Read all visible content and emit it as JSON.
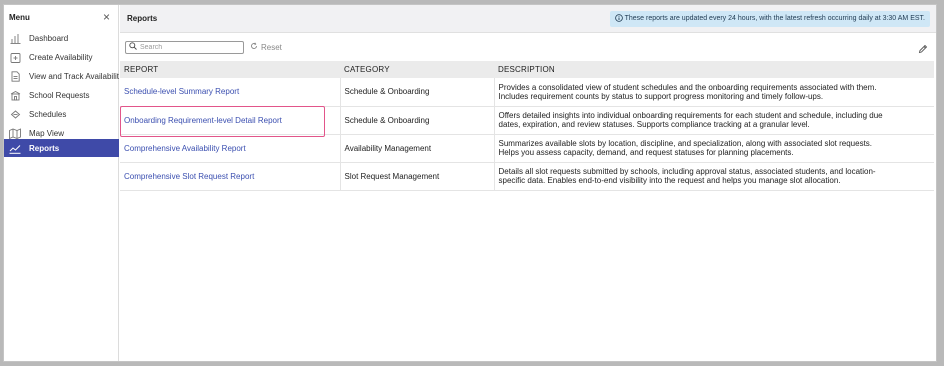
{
  "sidebar": {
    "title": "Menu",
    "close_icon": "×",
    "items": [
      {
        "label": "Dashboard",
        "icon": "bar-chart-icon",
        "active": false
      },
      {
        "label": "Create Availability",
        "icon": "calendar-plus-icon",
        "active": false
      },
      {
        "label": "View and Track Availability",
        "icon": "document-icon",
        "active": false
      },
      {
        "label": "School Requests",
        "icon": "school-icon",
        "active": false
      },
      {
        "label": "Schedules",
        "icon": "schedule-icon",
        "active": false
      },
      {
        "label": "Map View",
        "icon": "map-icon",
        "active": false
      },
      {
        "label": "Reports",
        "icon": "trend-chart-icon",
        "active": true
      }
    ]
  },
  "header": {
    "title": "Reports",
    "notice": "These reports are updated every 24 hours, with the latest refresh occurring daily at 3:30 AM EST."
  },
  "toolbar": {
    "search_placeholder": "Search",
    "reset_label": "Reset"
  },
  "table": {
    "headers": [
      "REPORT",
      "CATEGORY",
      "DESCRIPTION"
    ],
    "rows": [
      {
        "report": "Schedule-level Summary Report",
        "category": "Schedule & Onboarding",
        "description_line1": "Provides a consolidated view of student schedules and the onboarding requirements associated with them.",
        "description_line2": "Includes requirement counts by status to support progress monitoring and timely follow-ups."
      },
      {
        "report": "Onboarding Requirement-level Detail Report",
        "category": "Schedule & Onboarding",
        "description_line1": "Offers detailed insights into individual onboarding requirements for each student and schedule, including due",
        "description_line2": "dates, expiration, and review statuses. Supports compliance tracking at a granular level."
      },
      {
        "report": "Comprehensive Availability Report",
        "category": "Availability Management",
        "description_line1": "Summarizes available slots by location, discipline, and specialization, along with associated slot requests.",
        "description_line2": "Helps you assess capacity, demand, and request statuses for planning placements."
      },
      {
        "report": "Comprehensive Slot Request Report",
        "category": "Slot Request Management",
        "description_line1": "Details all slot requests submitted by schools, including approval status, associated students, and location-",
        "description_line2": "specific data. Enables end-to-end visibility into the request and helps you manage slot allocation."
      }
    ]
  },
  "colors": {
    "active_nav": "#3f4aa8",
    "link": "#3b4fb0",
    "notice_bg": "#cfe7f6",
    "highlight": "#e2558a"
  }
}
